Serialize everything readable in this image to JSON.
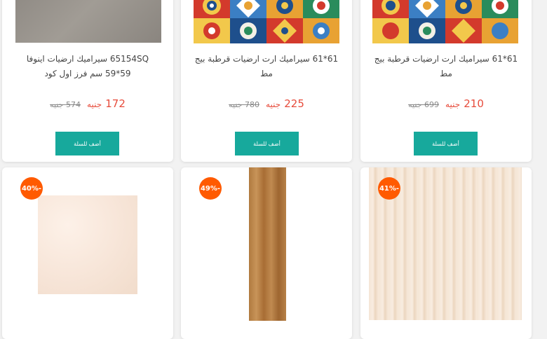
{
  "products_top": [
    {
      "title_line1": "65154SQ سيراميك ارضيات اينوفا",
      "title_line2": "59*59 سم فرز اول كود",
      "price": "172",
      "currency": "جنيه",
      "old_price": "574 جنيه",
      "button": "أضف للسلة"
    },
    {
      "title_line1": "61*61 سيراميك ارت ارضيات قرطبة بيج",
      "title_line2": "مط",
      "price": "225",
      "currency": "جنيه",
      "old_price": "780 جنيه",
      "button": "أضف للسلة"
    },
    {
      "title_line1": "61*61 سيراميك ارت ارضيات قرطبة بيج",
      "title_line2": "مط",
      "price": "210",
      "currency": "جنيه",
      "old_price": "699 جنيه",
      "button": "أضف للسلة"
    }
  ],
  "products_bottom": [
    {
      "discount": "40%-"
    },
    {
      "discount": "49%-"
    },
    {
      "discount": "41%-"
    }
  ],
  "colors": {
    "button": "#17a99c",
    "badge": "#ff5a00",
    "price": "#e74c3c"
  }
}
